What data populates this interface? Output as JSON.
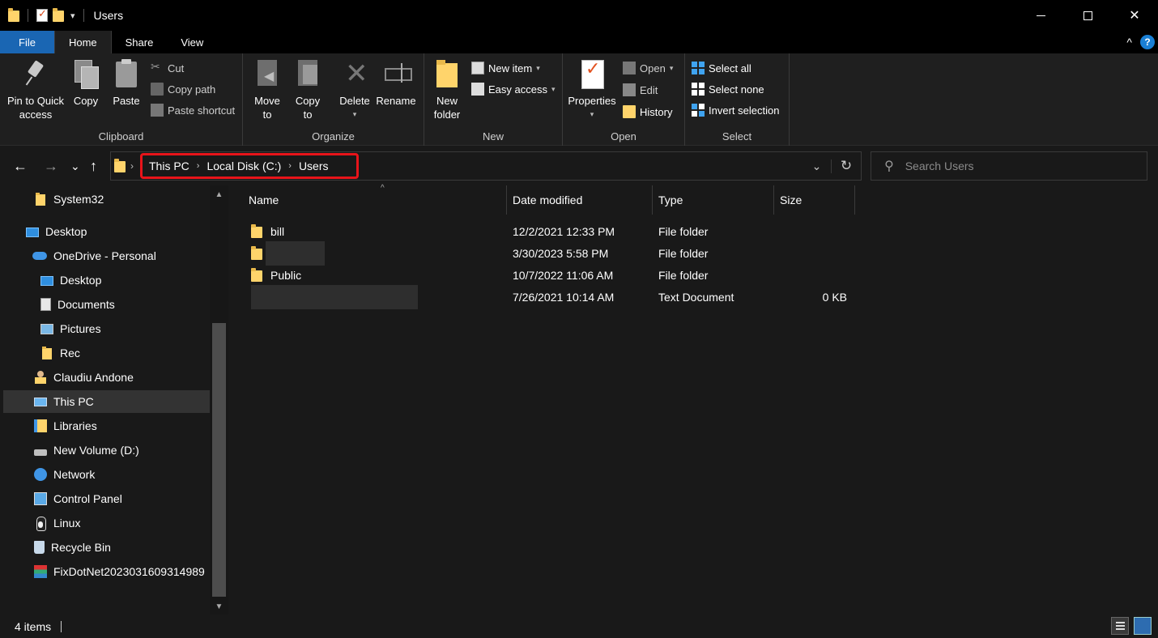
{
  "window": {
    "title": "Users",
    "controls": {
      "minimize": "minimize",
      "maximize": "maximize",
      "close": "✕"
    }
  },
  "quick_access_toolbar": {
    "dropdown": "▾"
  },
  "ribbon_tabs": [
    "File",
    "Home",
    "Share",
    "View"
  ],
  "ribbon_collapse_icon": "^",
  "help_label": "?",
  "ribbon": {
    "clipboard": {
      "label": "Clipboard",
      "pin_label_1": "Pin to Quick",
      "pin_label_2": "access",
      "copy": "Copy",
      "paste": "Paste",
      "cut": "Cut",
      "copy_path": "Copy path",
      "paste_shortcut": "Paste shortcut"
    },
    "organize": {
      "label": "Organize",
      "move_to_1": "Move",
      "move_to_2": "to",
      "copy_to_1": "Copy",
      "copy_to_2": "to",
      "delete": "Delete",
      "rename": "Rename"
    },
    "new": {
      "label": "New",
      "new_folder_1": "New",
      "new_folder_2": "folder",
      "new_item": "New item",
      "easy_access": "Easy access"
    },
    "open": {
      "label": "Open",
      "properties": "Properties",
      "open": "Open",
      "edit": "Edit",
      "history": "History"
    },
    "select": {
      "label": "Select",
      "select_all": "Select all",
      "select_none": "Select none",
      "invert_selection": "Invert selection"
    }
  },
  "nav_buttons": {
    "back": "←",
    "forward": "→",
    "recent": "⌄",
    "up": "↑"
  },
  "address": {
    "breadcrumbs": [
      "This PC",
      "Local Disk (C:)",
      "Users"
    ],
    "separator": "›"
  },
  "search": {
    "placeholder": "Search Users"
  },
  "nav_pane": {
    "items": [
      {
        "label": "System32",
        "icon": "folder-icon"
      },
      {
        "label": "Desktop",
        "icon": "desktop-icon"
      },
      {
        "label": "OneDrive - Personal",
        "icon": "onedrive-icon"
      },
      {
        "label": "Desktop",
        "icon": "desktop-icon"
      },
      {
        "label": "Documents",
        "icon": "documents-icon"
      },
      {
        "label": "Pictures",
        "icon": "pictures-icon"
      },
      {
        "label": "Rec",
        "icon": "folder-icon"
      },
      {
        "label": "Claudiu Andone",
        "icon": "user-folder-icon"
      },
      {
        "label": "This PC",
        "icon": "this-pc-icon",
        "selected": true
      },
      {
        "label": "Libraries",
        "icon": "libraries-icon"
      },
      {
        "label": "New Volume (D:)",
        "icon": "drive-icon"
      },
      {
        "label": "Network",
        "icon": "network-icon"
      },
      {
        "label": "Control Panel",
        "icon": "control-panel-icon"
      },
      {
        "label": "Linux",
        "icon": "linux-icon"
      },
      {
        "label": "Recycle Bin",
        "icon": "recycle-bin-icon"
      },
      {
        "label": "FixDotNet2023031609314989",
        "icon": "archive-icon"
      }
    ]
  },
  "file_list": {
    "columns": [
      "Name",
      "Date modified",
      "Type",
      "Size"
    ],
    "rows": [
      {
        "name": "bill",
        "date": "12/2/2021 12:33 PM",
        "type": "File folder",
        "size": "",
        "icon": "folder-icon"
      },
      {
        "name": "",
        "date": "3/30/2023 5:58 PM",
        "type": "File folder",
        "size": "",
        "icon": "folder-icon",
        "redacted": true
      },
      {
        "name": "Public",
        "date": "10/7/2022 11:06 AM",
        "type": "File folder",
        "size": "",
        "icon": "folder-icon"
      },
      {
        "name": "",
        "date": "7/26/2021 10:14 AM",
        "type": "Text Document",
        "size": "0 KB",
        "icon": "",
        "redacted": true
      }
    ]
  },
  "status": {
    "item_count": "4 items"
  },
  "colors": {
    "background": "#191919",
    "titlebar": "#000000",
    "file_tab": "#1a66b3",
    "highlight_box": "#e8141a",
    "folder": "#ffd46b",
    "selected_nav": "#333333"
  }
}
